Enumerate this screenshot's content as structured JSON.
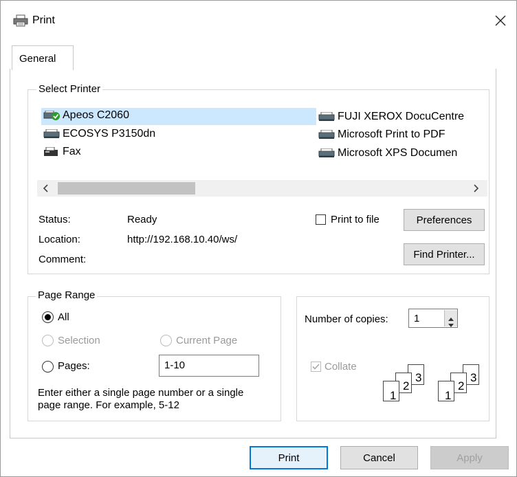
{
  "dialog": {
    "title": "Print"
  },
  "tabs": [
    {
      "label": "General"
    }
  ],
  "select_printer": {
    "legend": "Select Printer",
    "printers": [
      {
        "name": "Apeos C2060",
        "selected": true
      },
      {
        "name": "ECOSYS P3150dn"
      },
      {
        "name": "Fax"
      },
      {
        "name": "FUJI XEROX DocuCentre"
      },
      {
        "name": "Microsoft Print to PDF"
      },
      {
        "name": "Microsoft XPS Documen"
      }
    ],
    "status_label": "Status:",
    "status_value": "Ready",
    "location_label": "Location:",
    "location_value": "http://192.168.10.40/ws/",
    "comment_label": "Comment:",
    "comment_value": "",
    "print_to_file_label": "Print to file",
    "print_to_file_checked": false,
    "preferences_label": "Preferences",
    "find_printer_label": "Find Printer..."
  },
  "page_range": {
    "legend": "Page Range",
    "all_label": "All",
    "selection_label": "Selection",
    "current_page_label": "Current Page",
    "pages_label": "Pages:",
    "pages_value": "1-10",
    "help_line1": "Enter either a single page number or a single",
    "help_line2": "page range.  For example, 5-12",
    "selected": "all"
  },
  "copies": {
    "number_label": "Number of copies:",
    "number_value": "1",
    "collate_label": "Collate",
    "collate_checked": true,
    "collate_digits": [
      "1",
      "2",
      "3"
    ]
  },
  "footer": {
    "print_label": "Print",
    "cancel_label": "Cancel",
    "apply_label": "Apply"
  },
  "colors": {
    "selection_bg": "#cce8ff",
    "default_button_border": "#0078d7",
    "printer_ready_green": "#2e9b2e"
  }
}
